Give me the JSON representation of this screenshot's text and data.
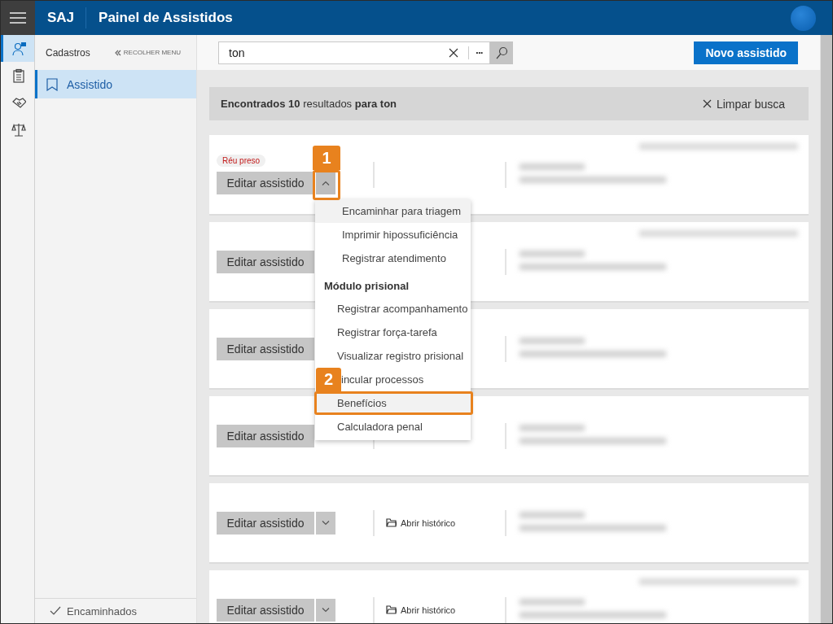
{
  "header": {
    "brand": "SAJ",
    "title": "Painel de Assistidos"
  },
  "rail": [
    {
      "selected": true
    },
    {
      "selected": false
    },
    {
      "selected": false
    },
    {
      "selected": false
    }
  ],
  "sidebar": {
    "title": "Cadastros",
    "collapse": "RECOLHER MENU",
    "items": [
      {
        "label": "Assistido",
        "selected": true
      }
    ],
    "footer": "Encaminhados"
  },
  "search": {
    "value": "ton",
    "more": "•••"
  },
  "new_button": "Novo assistido",
  "results": {
    "summary": "**Encontrados 10** resultados **para ton**",
    "clear": "Limpar busca"
  },
  "cards": [
    {
      "badge": "Réu preso",
      "edit": "Editar assistido",
      "menu_open": true,
      "blurred_header": true
    },
    {
      "edit": "Editar assistido",
      "blurred_header": true
    },
    {
      "edit": "Editar assistido",
      "blurred_header": false
    },
    {
      "edit": "Editar assistido",
      "blurred_header": false
    },
    {
      "edit": "Editar assistido",
      "menu_open": false,
      "history": "Abrir histórico",
      "blurred_header": false
    },
    {
      "edit": "Editar assistido",
      "menu_open": false,
      "history": "Abrir histórico",
      "blurred_header": true
    }
  ],
  "menu": [
    {
      "kind": "item",
      "label": "Encaminhar para triagem",
      "highlighted": true
    },
    {
      "kind": "item",
      "label": "Imprimir hipossuficiência",
      "highlighted": false
    },
    {
      "kind": "item",
      "label": "Registrar atendimento",
      "highlighted": false
    },
    {
      "kind": "header",
      "label": "Módulo prisional"
    },
    {
      "kind": "subitem",
      "label": "Registrar acompanhamento",
      "highlighted": false
    },
    {
      "kind": "subitem",
      "label": "Registrar força-tarefa",
      "highlighted": false
    },
    {
      "kind": "subitem",
      "label": "Visualizar registro prisional",
      "highlighted": false
    },
    {
      "kind": "partial",
      "label": "incular processos",
      "highlighted": false
    },
    {
      "kind": "subitem",
      "label": "Benefícios",
      "highlighted": true
    },
    {
      "kind": "subitem",
      "label": "Calculadora penal",
      "highlighted": false
    }
  ],
  "annotations": [
    {
      "label": "1"
    },
    {
      "label": "2"
    }
  ]
}
